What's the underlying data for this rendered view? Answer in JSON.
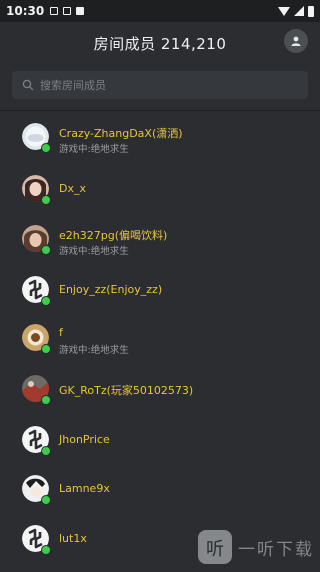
{
  "status_bar": {
    "time": "10:30"
  },
  "header": {
    "title": "房间成员 214,210"
  },
  "search": {
    "placeholder": "搜索房间成员"
  },
  "members": [
    {
      "name": "Crazy-ZhangDaX(潇洒)",
      "status": "游戏中:绝地求生",
      "avatar": "cloud-avatar",
      "online": true
    },
    {
      "name": "Dx_x",
      "status": "",
      "avatar": "girl-avatar",
      "online": true
    },
    {
      "name": "e2h327pg(偏喝饮料)",
      "status": "游戏中:绝地求生",
      "avatar": "girl2-avatar",
      "online": true
    },
    {
      "name": "Enjoy_zz(Enjoy_zz)",
      "status": "",
      "avatar": "default-logo-avatar",
      "online": true
    },
    {
      "name": "f",
      "status": "游戏中:绝地求生",
      "avatar": "cup-avatar",
      "online": true
    },
    {
      "name": "GK_RoTz(玩家50102573)",
      "status": "",
      "avatar": "photo-avatar",
      "online": true
    },
    {
      "name": "JhonPrice",
      "status": "",
      "avatar": "default-logo-avatar",
      "online": true
    },
    {
      "name": "Lamne9x",
      "status": "",
      "avatar": "anime-avatar",
      "online": true
    },
    {
      "name": "lut1x",
      "status": "",
      "avatar": "default-logo-avatar",
      "online": true
    }
  ],
  "watermark": {
    "logo_text": "听",
    "brand": "一听下载"
  },
  "colors": {
    "name": "#e8c53a",
    "online": "#3ccd4a",
    "background": "#2b2d30"
  }
}
